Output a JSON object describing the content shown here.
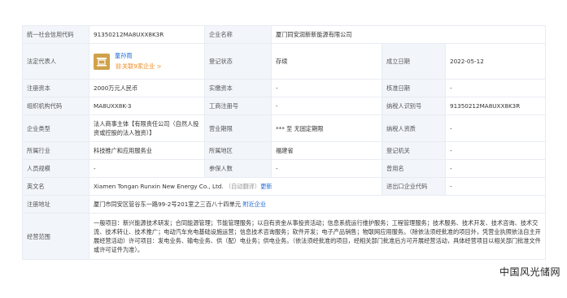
{
  "rows": {
    "credit_code_label": "统一社会信用代码",
    "credit_code": "91350212MA8UXX8K3R",
    "company_name_label": "企业名称",
    "company_name": "厦门同安润新新能源有限公司",
    "legal_rep_label": "法定代表人",
    "legal_rep_avatar_char": "童",
    "legal_rep_name": "童孙雨",
    "legal_rep_related": "关联9家企业 >",
    "reg_status_label": "登记状态",
    "reg_status": "存续",
    "established_label": "成立日期",
    "established": "2022-05-12",
    "capital_label": "注册资本",
    "capital": "2000万元人民币",
    "paid_capital_label": "实缴资本",
    "paid_capital": "-",
    "approval_date_label": "核准日期",
    "approval_date": "-",
    "org_code_label": "组织机构代码",
    "org_code": "MA8UXX8K-3",
    "biz_reg_no_label": "工商注册号",
    "biz_reg_no": "-",
    "taxpayer_id_label": "纳税人识别号",
    "taxpayer_id": "91350212MA8UXX8K3R",
    "company_type_label": "企业类型",
    "company_type": "法人商事主体【有限责任公司（自然人投资或控股的法人独资）】",
    "biz_term_label": "营业期限",
    "biz_term": "*** 至 无固定期限",
    "taxpayer_qual_label": "纳税人资质",
    "taxpayer_qual": "-",
    "industry_label": "所属行业",
    "industry": "科技推广和应用服务业",
    "region_label": "所属地区",
    "region": "福建省",
    "reg_authority_label": "登记机关",
    "reg_authority": "-",
    "staff_size_label": "人员规模",
    "staff_size": "-",
    "insured_label": "参保人数",
    "insured": "-",
    "former_name_label": "曾用名",
    "former_name": "-",
    "english_name_label": "英文名",
    "english_name": "Xiamen Tongan Runxin New Energy Co., Ltd.",
    "english_name_note": "（自动翻译）",
    "english_name_link": "更新",
    "import_export_label": "进出口企业代码",
    "import_export": "-",
    "address_label": "注册地址",
    "address": "厦门市同安区管谷东一路99-2号201室之三百八十四单元",
    "address_link": "附近企业",
    "scope_label": "经营范围",
    "scope": "一般项目：新兴能源技术研发；合同能源管理；节能管理服务；以自有资金从事投资活动；信息系统运行维护服务；工程管理服务；技术服务、技术开发、技术咨询、技术交流、技术转让、技术推广；电动汽车充电基础设施运营；信息技术咨询服务；软件开发；电子产品销售；物联网应用服务。（除依法须经批准的项目外，凭营业执照依法自主开展经营活动）许可项目：发电业务、输电业务、供（配）电业务；供电业务。（依法须经批准的项目，经相关部门批准后方可开展经营活动，具体经营项目以相关部门批准文件或许可证件为准）。"
  },
  "watermark": "中国风光储网"
}
